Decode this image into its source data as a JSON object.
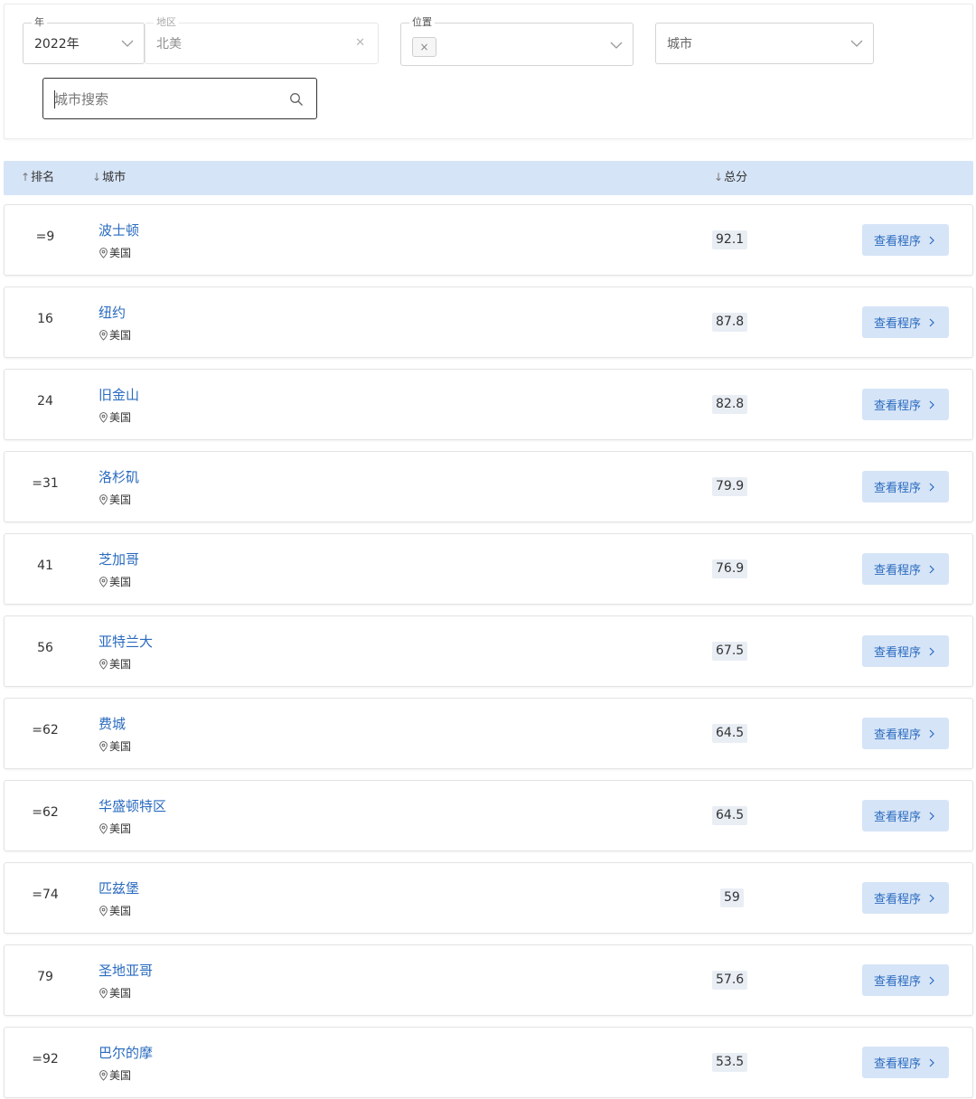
{
  "filters": {
    "year": {
      "legend": "年",
      "value": "2022年"
    },
    "region": {
      "legend": "地区",
      "value": "北美"
    },
    "location": {
      "legend": "位置",
      "chip": "×"
    },
    "city": {
      "placeholder": "城市"
    },
    "search": {
      "placeholder": "城市搜索"
    }
  },
  "table": {
    "headers": {
      "rank": "排名",
      "city": "城市",
      "score": "总分"
    },
    "button_label": "查看程序",
    "rows": [
      {
        "rank": "=9",
        "city": "波士顿",
        "country": "美国",
        "score": "92.1"
      },
      {
        "rank": "16",
        "city": "纽约",
        "country": "美国",
        "score": "87.8"
      },
      {
        "rank": "24",
        "city": "旧金山",
        "country": "美国",
        "score": "82.8"
      },
      {
        "rank": "=31",
        "city": "洛杉矶",
        "country": "美国",
        "score": "79.9"
      },
      {
        "rank": "41",
        "city": "芝加哥",
        "country": "美国",
        "score": "76.9"
      },
      {
        "rank": "56",
        "city": "亚特兰大",
        "country": "美国",
        "score": "67.5"
      },
      {
        "rank": "=62",
        "city": "费城",
        "country": "美国",
        "score": "64.5"
      },
      {
        "rank": "=62",
        "city": "华盛顿特区",
        "country": "美国",
        "score": "64.5"
      },
      {
        "rank": "=74",
        "city": "匹兹堡",
        "country": "美国",
        "score": "59"
      },
      {
        "rank": "79",
        "city": "圣地亚哥",
        "country": "美国",
        "score": "57.6"
      },
      {
        "rank": "=92",
        "city": "巴尔的摩",
        "country": "美国",
        "score": "53.5"
      }
    ]
  },
  "icons": {
    "dropdown": "chevron-down-icon",
    "clear": "close-icon",
    "search": "search-icon",
    "location": "location-pin-icon",
    "button_arrow": "chevron-right-icon",
    "sort_asc": "arrow-up-icon",
    "sort_desc": "arrow-down-icon"
  },
  "colors": {
    "accent_link": "#2a6bbf",
    "header_bg": "#d6e4f7",
    "button_bg": "#d6e4f7",
    "score_bg": "#e9eef5"
  }
}
